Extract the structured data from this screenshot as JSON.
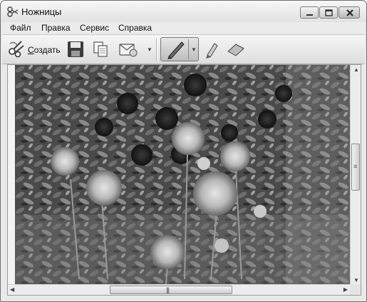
{
  "window": {
    "title": "Ножницы"
  },
  "menu": {
    "items": [
      {
        "label": "Файл"
      },
      {
        "label": "Правка"
      },
      {
        "label": "Сервис"
      },
      {
        "label": "Справка"
      }
    ]
  },
  "toolbar": {
    "new_label_first": "С",
    "new_label_rest": "оздать",
    "icons": [
      "scissors-icon",
      "save-icon",
      "copy-icon",
      "send-icon",
      "pen-icon",
      "highlighter-icon",
      "eraser-icon"
    ]
  },
  "canvas": {
    "description_icon": "flower-photo",
    "vscroll_position": 0.38,
    "hscroll_position": 0.5
  },
  "colors": {
    "window_frame": "#6f6f6f",
    "toolbar_bg": "#e6e6e6"
  }
}
